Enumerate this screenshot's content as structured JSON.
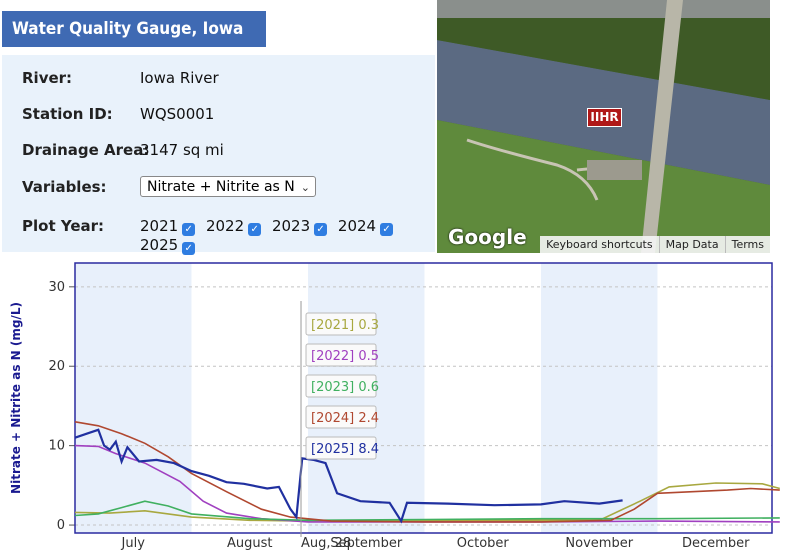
{
  "header": {
    "title": "Water Quality Gauge, Iowa City, IA"
  },
  "info": {
    "river_label": "River:",
    "river_value": "Iowa River",
    "station_label": "Station ID:",
    "station_value": "WQS0001",
    "drainage_label": "Drainage Area:",
    "drainage_value": "3147 sq mi",
    "variables_label": "Variables:",
    "variables_value": "Nitrate + Nitrite as N",
    "plot_year_label": "Plot Year:",
    "years": [
      {
        "label": "2021",
        "checked": true
      },
      {
        "label": "2022",
        "checked": true
      },
      {
        "label": "2023",
        "checked": true
      },
      {
        "label": "2024",
        "checked": true
      },
      {
        "label": "2025",
        "checked": true
      }
    ]
  },
  "map": {
    "marker": "IIHR",
    "logo": "Google",
    "links": [
      "Keyboard shortcuts",
      "Map Data",
      "Terms"
    ]
  },
  "chart_data": {
    "type": "line",
    "ylabel": "Nitrate + Nitrite as N (mg/L)",
    "ylim": [
      -1,
      33
    ],
    "yticks": [
      0,
      10,
      20,
      30
    ],
    "months": [
      "July",
      "August",
      "September",
      "October",
      "November",
      "December"
    ],
    "cursor_label": "Aug, 28",
    "grid": true,
    "colors": {
      "2021": "#a8a840",
      "2022": "#a040c0",
      "2023": "#40b060",
      "2024": "#b04830",
      "2025": "#2030a0"
    },
    "tooltip": [
      {
        "year": "2021",
        "text": "[2021] 0.3"
      },
      {
        "year": "2022",
        "text": "[2022] 0.5"
      },
      {
        "year": "2023",
        "text": "[2023] 0.6"
      },
      {
        "year": "2024",
        "text": "[2024] 2.4"
      },
      {
        "year": "2025",
        "text": "[2025] 8.4"
      }
    ],
    "series": [
      {
        "name": "2021",
        "points": [
          [
            0,
            1.6
          ],
          [
            0.3,
            1.5
          ],
          [
            0.6,
            1.8
          ],
          [
            1.0,
            1.0
          ],
          [
            1.5,
            0.6
          ],
          [
            2.0,
            0.5
          ],
          [
            2.5,
            0.5
          ],
          [
            3.5,
            0.6
          ],
          [
            4.5,
            0.6
          ],
          [
            4.85,
            3.0
          ],
          [
            5.1,
            4.8
          ],
          [
            5.5,
            5.3
          ],
          [
            5.9,
            5.2
          ],
          [
            6.05,
            4.6
          ]
        ]
      },
      {
        "name": "2022",
        "points": [
          [
            0,
            10.0
          ],
          [
            0.2,
            9.9
          ],
          [
            0.35,
            9.0
          ],
          [
            0.6,
            7.8
          ],
          [
            0.9,
            5.5
          ],
          [
            1.1,
            3.0
          ],
          [
            1.3,
            1.5
          ],
          [
            1.6,
            0.8
          ],
          [
            2.0,
            0.4
          ],
          [
            3.0,
            0.4
          ],
          [
            4.0,
            0.4
          ],
          [
            5.0,
            0.5
          ],
          [
            6.05,
            0.4
          ]
        ]
      },
      {
        "name": "2023",
        "points": [
          [
            0,
            1.2
          ],
          [
            0.2,
            1.4
          ],
          [
            0.4,
            2.2
          ],
          [
            0.6,
            3.0
          ],
          [
            0.8,
            2.4
          ],
          [
            1.0,
            1.4
          ],
          [
            1.5,
            0.8
          ],
          [
            2.0,
            0.6
          ],
          [
            3.0,
            0.7
          ],
          [
            4.0,
            0.8
          ],
          [
            5.0,
            0.8
          ],
          [
            6.05,
            0.9
          ]
        ]
      },
      {
        "name": "2024",
        "points": [
          [
            0,
            13.0
          ],
          [
            0.2,
            12.5
          ],
          [
            0.4,
            11.5
          ],
          [
            0.6,
            10.3
          ],
          [
            0.8,
            8.6
          ],
          [
            1.0,
            6.5
          ],
          [
            1.3,
            4.2
          ],
          [
            1.6,
            2.0
          ],
          [
            1.85,
            1.0
          ],
          [
            2.2,
            0.5
          ],
          [
            3.0,
            0.4
          ],
          [
            4.0,
            0.4
          ],
          [
            4.6,
            0.6
          ],
          [
            4.8,
            2.0
          ],
          [
            5.0,
            4.0
          ],
          [
            5.3,
            4.2
          ],
          [
            5.6,
            4.4
          ],
          [
            5.8,
            4.6
          ],
          [
            6.05,
            4.4
          ]
        ]
      },
      {
        "name": "2025",
        "points": [
          [
            0,
            11.0
          ],
          [
            0.1,
            11.5
          ],
          [
            0.2,
            12.0
          ],
          [
            0.25,
            10.0
          ],
          [
            0.3,
            9.5
          ],
          [
            0.35,
            10.5
          ],
          [
            0.4,
            8.0
          ],
          [
            0.45,
            9.8
          ],
          [
            0.55,
            8.0
          ],
          [
            0.7,
            8.2
          ],
          [
            0.85,
            7.8
          ],
          [
            1.0,
            6.8
          ],
          [
            1.15,
            6.2
          ],
          [
            1.3,
            5.4
          ],
          [
            1.45,
            5.2
          ],
          [
            1.65,
            4.6
          ],
          [
            1.75,
            4.8
          ],
          [
            1.85,
            2.0
          ],
          [
            1.9,
            1.0
          ],
          [
            1.95,
            8.4
          ],
          [
            2.05,
            8.2
          ],
          [
            2.15,
            7.8
          ],
          [
            2.25,
            4.0
          ],
          [
            2.45,
            3.0
          ],
          [
            2.7,
            2.8
          ],
          [
            2.8,
            0.5
          ],
          [
            2.85,
            2.8
          ],
          [
            3.2,
            2.7
          ],
          [
            3.6,
            2.5
          ],
          [
            4.0,
            2.6
          ],
          [
            4.2,
            3.0
          ],
          [
            4.5,
            2.7
          ],
          [
            4.7,
            3.1
          ]
        ]
      }
    ]
  }
}
